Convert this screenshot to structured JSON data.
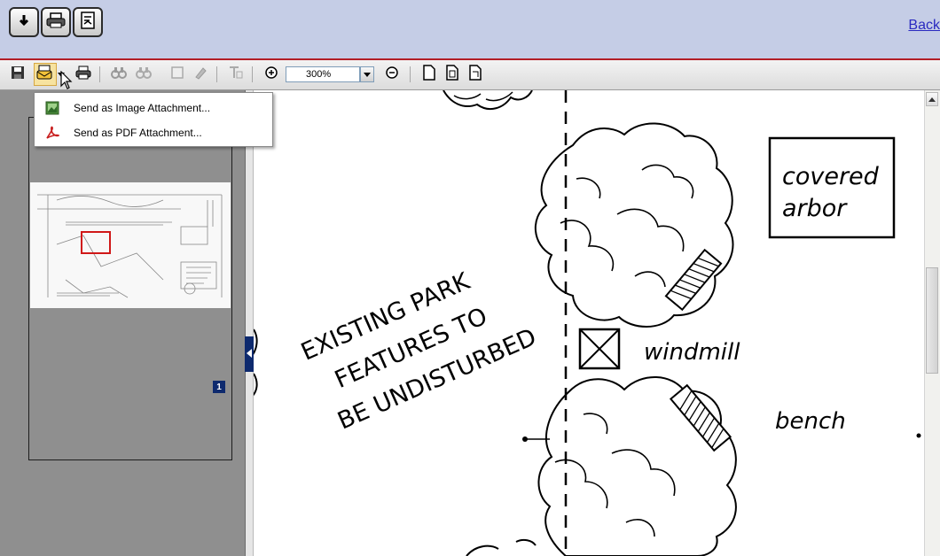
{
  "topbar": {
    "back_label": "Back",
    "buttons": [
      {
        "icon": "download-arrow-icon"
      },
      {
        "icon": "printer-icon"
      },
      {
        "icon": "document-view-icon"
      }
    ]
  },
  "toolbar": {
    "zoom_value": "300%",
    "icons": [
      "save-icon",
      "email-icon",
      "print-icon",
      "find-icon",
      "find-next-icon",
      "select-icon",
      "highlight-icon",
      "text-tool-icon",
      "zoom-in-icon",
      "zoom-out-icon",
      "fit-page-icon",
      "fit-width-icon",
      "rotate-page-icon"
    ]
  },
  "popup_menu": {
    "items": [
      {
        "label": "Send as Image Attachment...",
        "icon": "image-attachment-icon"
      },
      {
        "label": "Send as PDF Attachment...",
        "icon": "pdf-attachment-icon"
      }
    ]
  },
  "thumbnails": {
    "page_badge": "1"
  },
  "document": {
    "note_line1": "EXISTING PARK",
    "note_line2": "FEATURES TO",
    "note_line3": "BE UNDISTURBED",
    "label_covered": "covered",
    "label_arbor": "arbor",
    "label_windmill": "windmill",
    "label_bench": "bench"
  },
  "colors": {
    "topbar_bg": "#c5cde6",
    "accent_red": "#b31e26",
    "link_blue": "#2a2ac0",
    "pane_gray": "#8f8f8f",
    "badge_navy": "#0e2a6e"
  }
}
